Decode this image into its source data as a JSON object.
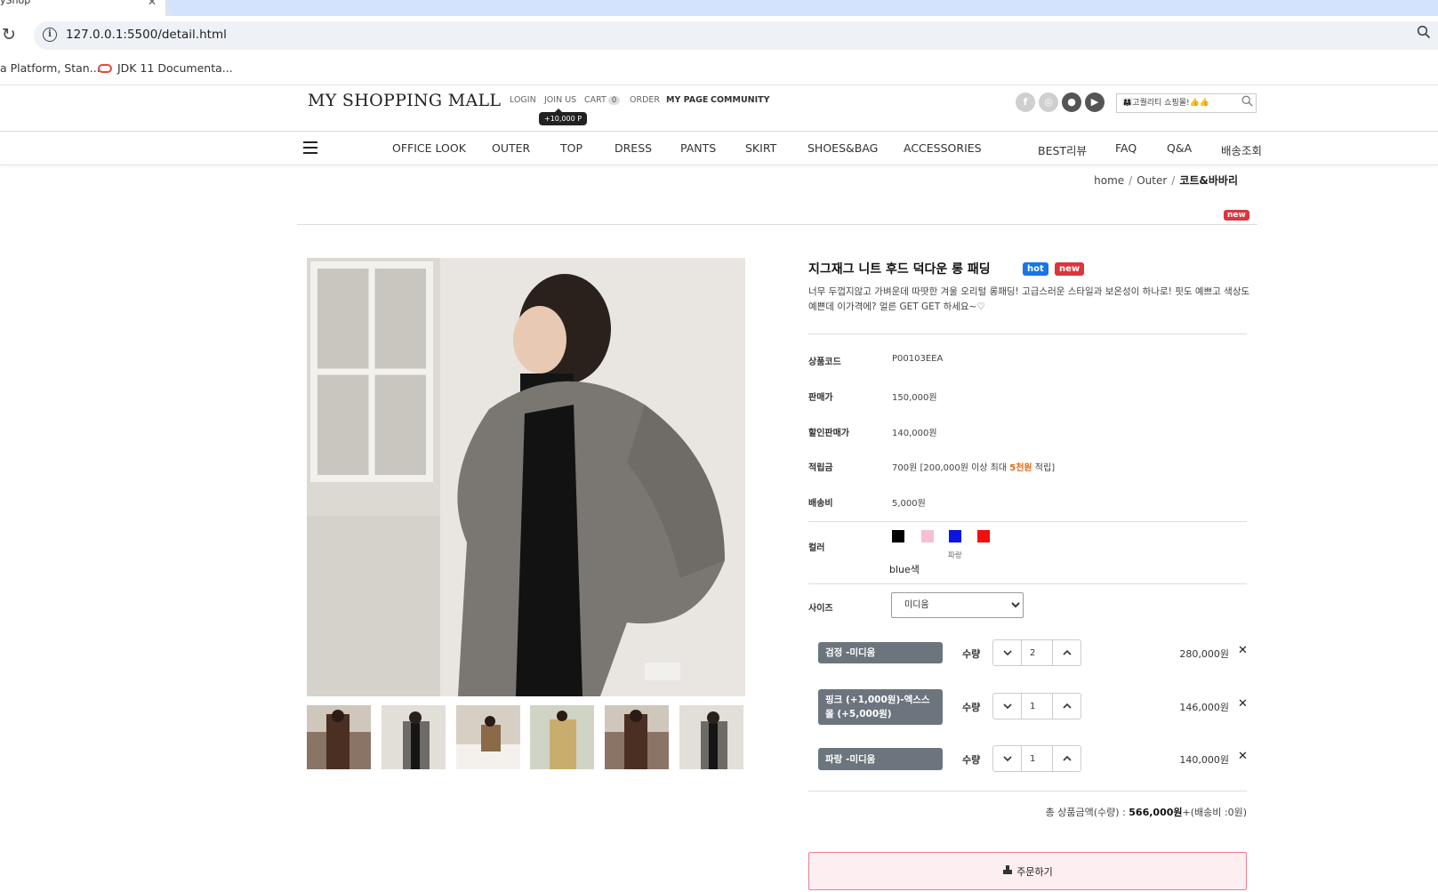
{
  "browser": {
    "tab_title": "yShop",
    "url": "127.0.0.1:5500/detail.html",
    "bookmarks": [
      {
        "label": "a Platform, Stan..."
      },
      {
        "label": "JDK 11 Documenta..."
      }
    ]
  },
  "header": {
    "logo": "MY SHOPPING MALL",
    "links": {
      "login": "LOGIN",
      "join": "JOIN US",
      "cart": "CART",
      "cart_count": "0",
      "order": "ORDER",
      "mypage": "MY PAGE",
      "community": "COMMUNITY"
    },
    "join_tooltip": "+10,000 P",
    "search_value": "👩‍👩‍👧고퀄리티 쇼핑몰!👍👍",
    "sns_icons": [
      "facebook-icon",
      "instagram-icon",
      "talk-icon",
      "youtube-icon"
    ]
  },
  "nav": {
    "items": [
      "OFFICE LOOK",
      "OUTER",
      "TOP",
      "DRESS",
      "PANTS",
      "SKIRT",
      "SHOES&BAG",
      "ACCESSORIES"
    ],
    "right_items": [
      "BEST리뷰",
      "FAQ",
      "Q&A",
      "배송조회"
    ]
  },
  "breadcrumb": {
    "home": "home",
    "category": "Outer",
    "current": "코트&바바리"
  },
  "top_badge": "new",
  "product": {
    "name": "지그재그 니트 후드 덕다운 롱 패딩",
    "badges": {
      "hot": "hot",
      "new": "new"
    },
    "description": "너무 두껍지않고 가벼운데 따땃한 겨울 오리털 롱패딩! 고급스러운 스타일과 보온성이 하나로! 핏도 예쁘고 색상도 예쁜데 이가격에? 얼른 GET GET 하세요~♡",
    "info": {
      "code_label": "상품코드",
      "code_value": "P00103EEA",
      "price_label": "판매가",
      "price_value": "150,000원",
      "sale_label": "할인판매가",
      "sale_value": "140,000원",
      "points_label": "적립금",
      "points_pre": "700원 [200,000원 이상 최대 ",
      "points_highlight": "5천원",
      "points_post": " 적립]",
      "shipping_label": "배송비",
      "shipping_value": "5,000원"
    },
    "color": {
      "label": "컬러",
      "swatches": [
        "#000000",
        "#f7bfd0",
        "#0a14e6",
        "#f20f0f"
      ],
      "hover_caption": "파랑",
      "selected_text": "blue색"
    },
    "size": {
      "label": "사이즈",
      "selected": "미디움"
    },
    "selected_options": [
      {
        "tag": "검정 -미디움",
        "qty_label": "수량",
        "qty": "2",
        "price": "280,000원"
      },
      {
        "tag": "핑크 (+1,000원)-엑스스몰 (+5,000원)",
        "qty_label": "수량",
        "qty": "1",
        "price": "146,000원"
      },
      {
        "tag": "파랑 -미디움",
        "qty_label": "수량",
        "qty": "1",
        "price": "140,000원"
      }
    ],
    "total": {
      "prefix": "총 상품금액(수량) : ",
      "amount": "566,000원",
      "suffix": "+(배송비 :0원)"
    },
    "order_button": "주문하기"
  }
}
